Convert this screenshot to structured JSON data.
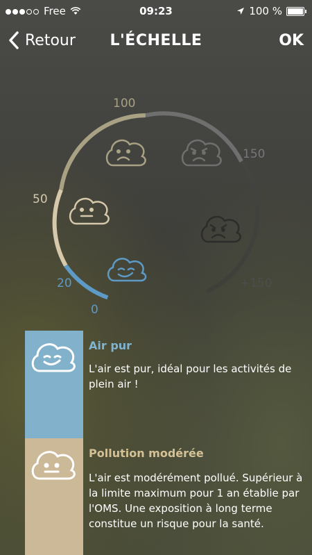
{
  "status": {
    "carrier": "Free",
    "time": "09:23",
    "battery": "100 %"
  },
  "nav": {
    "back_label": "Retour",
    "title": "L'ÉCHELLE",
    "ok_label": "OK"
  },
  "gauge": {
    "labels": {
      "v0": "0",
      "v20": "20",
      "v50": "50",
      "v100": "100",
      "v150": "150",
      "vplus150": "+150"
    },
    "faces": [
      "face-happy-icon",
      "face-neutral-icon",
      "face-unhappy-icon",
      "face-angry-icon",
      "face-very-angry-icon"
    ]
  },
  "cards": [
    {
      "title": "Air pur",
      "text": "L'air est pur, idéal pour les activités de plein air !",
      "color": "#82b1cb",
      "title_color": "#7fb4d2"
    },
    {
      "title": "Pollution modérée",
      "text": "L'air est modérément pollué. Supérieur à la limite maximum pour 1 an établie par l'OMS. Une exposition à long terme constitue un risque pour la santé.",
      "color": "#cbb997",
      "title_color": "#d4c196"
    }
  ],
  "colors": {
    "blue": "#5d9ac6",
    "sand": "#d6c9ab",
    "khaki": "#a9a184",
    "grey": "#6f6f6f",
    "dark": "#2c2c2a"
  }
}
